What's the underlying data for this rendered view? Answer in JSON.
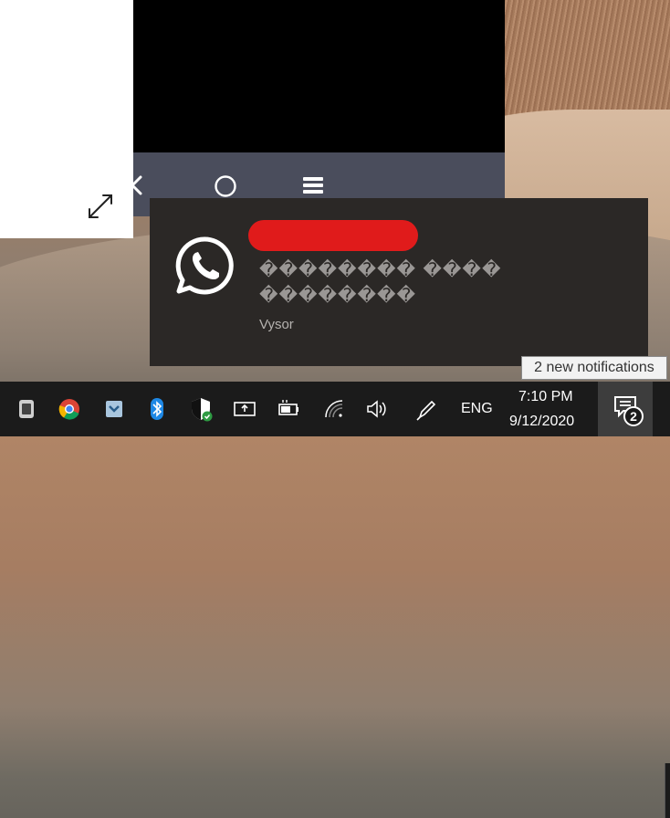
{
  "notification": {
    "app": "WhatsApp",
    "line1": "�������� ����",
    "line2": "��������",
    "source": "Vysor"
  },
  "tooltip": {
    "text": "2 new notifications"
  },
  "taskbar": {
    "language": "ENG",
    "time": "7:10 PM",
    "date": "9/12/2020",
    "notification_count": "2",
    "pinned_icons": [
      "vysor-icon",
      "chrome-icon",
      "files-icon",
      "bluetooth-icon",
      "security-shield-icon",
      "display-icon",
      "battery-icon",
      "wifi-icon",
      "volume-icon",
      "pen-icon"
    ]
  },
  "colors": {
    "taskbar": "#1b1b1b",
    "toast_bg": "#2b2826",
    "redaction": "#e01b1b",
    "phone_nav": "#4a4d5c"
  }
}
